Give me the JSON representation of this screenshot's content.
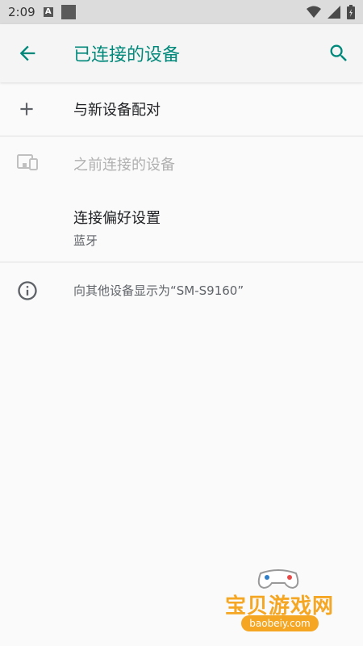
{
  "status_bar": {
    "time": "2:09",
    "notification_letter": "A"
  },
  "header": {
    "title": "已连接的设备"
  },
  "items": {
    "pair_new": "与新设备配对",
    "previous": "之前连接的设备",
    "preferences_title": "连接偏好设置",
    "preferences_sub": "蓝牙"
  },
  "info": {
    "text": "向其他设备显示为“SM-S9160”"
  },
  "watermark": {
    "name": "宝贝游戏网",
    "url": "baobeiy.com"
  },
  "colors": {
    "accent": "#00897b",
    "status_bar_bg": "#dcdcdc",
    "watermark": "#f5a623"
  },
  "icons": [
    "back-arrow-icon",
    "search-icon",
    "plus-icon",
    "devices-icon",
    "info-icon",
    "wifi-icon",
    "cell-signal-icon",
    "battery-icon"
  ]
}
